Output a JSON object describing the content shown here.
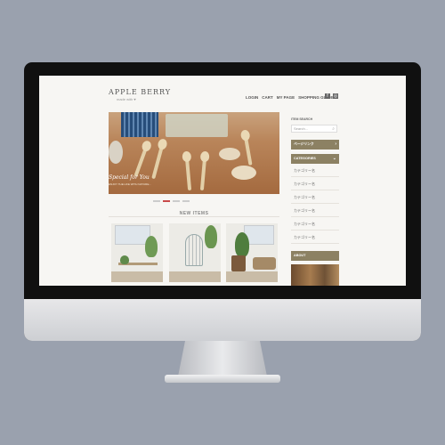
{
  "site": {
    "logo": "APPLE BERRY",
    "logo_sub": "made with ♥",
    "nav": [
      "LOGIN",
      "CART",
      "MY PAGE",
      "SHOPPING GUIDE"
    ],
    "sns_icons": [
      "facebook-icon",
      "instagram-icon"
    ]
  },
  "hero": {
    "caption": "Special for You",
    "sub": "ENJOY THE LIFE WITH NATURE..."
  },
  "section": {
    "new_items": "NEW ITEMS"
  },
  "sidebar": {
    "search_label": "ITEM SEARCH",
    "search_placeholder": "Search...",
    "page_link": "ページリンク",
    "categories_label": "CATEGORIES",
    "categories": [
      "カテゴリー名",
      "カテゴリー名",
      "カテゴリー名",
      "カテゴリー名",
      "カテゴリー名",
      "カテゴリー名"
    ],
    "about_label": "ABOUT"
  },
  "colors": {
    "accent": "#8c8163",
    "slider_active": "#c94a4a",
    "background": "#9aa1ae"
  }
}
